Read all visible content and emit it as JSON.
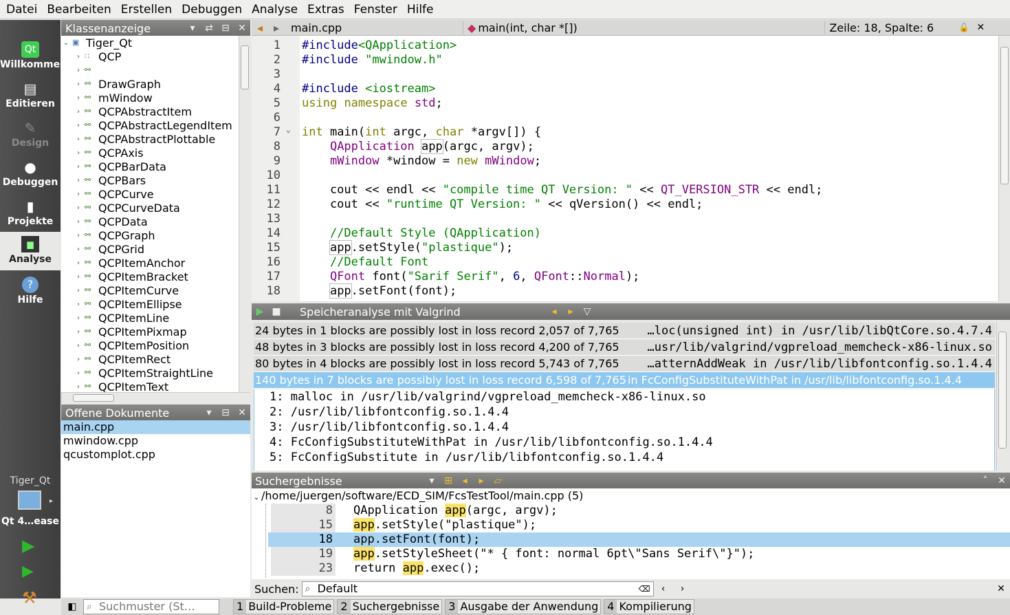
{
  "menu": [
    "Datei",
    "Bearbeiten",
    "Erstellen",
    "Debuggen",
    "Analyse",
    "Extras",
    "Fenster",
    "Hilfe"
  ],
  "modes": [
    {
      "label": "Willkommen",
      "icon": "qt-logo-icon"
    },
    {
      "label": "Editieren",
      "icon": "document-icon"
    },
    {
      "label": "Design",
      "icon": "pencil-icon"
    },
    {
      "label": "Debuggen",
      "icon": "bug-icon"
    },
    {
      "label": "Projekte",
      "icon": "wrench-icon"
    },
    {
      "label": "Analyse",
      "icon": "monitor-icon"
    },
    {
      "label": "Hilfe",
      "icon": "help-icon"
    }
  ],
  "target": {
    "project": "Tiger_Qt",
    "kit": "Qt 4…ease"
  },
  "class_panel": {
    "title": "Klassenanzeige",
    "root": "Tiger_Qt",
    "items": [
      "QCP",
      "",
      "DrawGraph",
      "mWindow",
      "QCPAbstractItem",
      "QCPAbstractLegendItem",
      "QCPAbstractPlottable",
      "QCPAxis",
      "QCPBarData",
      "QCPBars",
      "QCPCurve",
      "QCPCurveData",
      "QCPData",
      "QCPGraph",
      "QCPGrid",
      "QCPItemAnchor",
      "QCPItemBracket",
      "QCPItemCurve",
      "QCPItemEllipse",
      "QCPItemLine",
      "QCPItemPixmap",
      "QCPItemPosition",
      "QCPItemRect",
      "QCPItemStraightLine",
      "QCPItemText"
    ]
  },
  "open_docs": {
    "title": "Offene Dokumente",
    "items": [
      "main.cpp",
      "mwindow.cpp",
      "qcustomplot.cpp"
    ]
  },
  "editor": {
    "file": "main.cpp",
    "symbol": "main(int, char *[])",
    "position": "Zeile: 18, Spalte: 6",
    "lines": [
      {
        "n": "1",
        "html": "<span class='pp'>#include</span><span class='s'>&lt;QApplication&gt;</span>"
      },
      {
        "n": "2",
        "html": "<span class='pp'>#include</span> <span class='s'>\"mwindow.h\"</span>"
      },
      {
        "n": "3",
        "html": ""
      },
      {
        "n": "4",
        "html": "<span class='pp'>#include</span> <span class='s'>&lt;iostream&gt;</span>"
      },
      {
        "n": "5",
        "html": "<span class='k'>using</span> <span class='k'>namespace</span> <span class='q'>std</span>;"
      },
      {
        "n": "6",
        "html": ""
      },
      {
        "n": "7",
        "html": "<span class='t'>int</span> main(<span class='t'>int</span> argc, <span class='t'>char</span> *argv[]) {",
        "fold": true
      },
      {
        "n": "8",
        "html": "    <span class='cl'>QApplication</span> <span class='boxed'>app</span>(argc, argv);"
      },
      {
        "n": "9",
        "html": "    <span class='cl'>mWindow</span> *window = <span class='k'>new</span> <span class='cl'>mWindow</span>;"
      },
      {
        "n": "10",
        "html": ""
      },
      {
        "n": "11",
        "html": "    cout &lt;&lt; endl &lt;&lt; <span class='s'>\"compile time QT Version: \"</span> &lt;&lt; <span class='q'>QT_VERSION_STR</span> &lt;&lt; endl;"
      },
      {
        "n": "12",
        "html": "    cout &lt;&lt; <span class='s'>\"runtime QT Version: \"</span> &lt;&lt; qVersion() &lt;&lt; endl;"
      },
      {
        "n": "13",
        "html": ""
      },
      {
        "n": "14",
        "html": "    <span class='cm'>//Default Style (QApplication)</span>"
      },
      {
        "n": "15",
        "html": "    <span class='boxed'>app</span>.setStyle(<span class='s'>\"plastique\"</span>);"
      },
      {
        "n": "16",
        "html": "    <span class='cm'>//Default Font</span>"
      },
      {
        "n": "17",
        "html": "    <span class='cl'>QFont</span> font(<span class='s'>\"Sarif Serif\"</span>, <span class='pp'>6</span>, <span class='cl'>QFont</span>::<span class='q'>Normal</span>);"
      },
      {
        "n": "18",
        "html": "    <span class='boxed'>app</span>.setFont(font);"
      }
    ]
  },
  "valgrind": {
    "title": "Speicheranalyse mit Valgrind",
    "rows": [
      {
        "left": "24 bytes in 1 blocks are possibly lost in loss record 2,057 of 7,765",
        "right": "…loc(unsigned int) in /usr/lib/libQtCore.so.4.7.4"
      },
      {
        "left": "48 bytes in 3 blocks are possibly lost in loss record 4,200 of 7,765",
        "right": "…usr/lib/valgrind/vgpreload_memcheck-x86-linux.so"
      },
      {
        "left": "80 bytes in 4 blocks are possibly lost in loss record 5,743 of 7,765",
        "right": "…atternAddWeak in /usr/lib/libfontconfig.so.1.4.4"
      },
      {
        "left": "140 bytes in 7 blocks are possibly lost in loss record 6,598 of 7,765",
        "right": "in FcConfigSubstituteWithPat in /usr/lib/libfontconfig.so.1.4.4"
      }
    ],
    "stack": [
      "1: malloc in /usr/lib/valgrind/vgpreload_memcheck-x86-linux.so",
      "2: /usr/lib/libfontconfig.so.1.4.4",
      "3: /usr/lib/libfontconfig.so.1.4.4",
      "4: FcConfigSubstituteWithPat in /usr/lib/libfontconfig.so.1.4.4",
      "5: FcConfigSubstitute in /usr/lib/libfontconfig.so.1.4.4"
    ]
  },
  "search": {
    "title": "Suchergebnisse",
    "file": "/home/juergen/software/ECD_SIM/FcsTestTool/main.cpp (5)",
    "results": [
      {
        "n": "8",
        "pre": "QApplication ",
        "hit": "app",
        "post": "(argc, argv);"
      },
      {
        "n": "15",
        "pre": "",
        "hit": "app",
        "post": ".setStyle(\"plastique\");"
      },
      {
        "n": "18",
        "pre": "",
        "hit": "app",
        "post": ".setFont(font);"
      },
      {
        "n": "19",
        "pre": "",
        "hit": "app",
        "post": ".setStyleSheet(\"* { font: normal 6pt\\\"Sans Serif\\\"}\");"
      },
      {
        "n": "23",
        "pre": "return ",
        "hit": "app",
        "post": ".exec();"
      }
    ]
  },
  "find": {
    "label": "Suchen:",
    "value": "Default"
  },
  "status": {
    "locator_placeholder": "Suchmuster (St…",
    "panes": [
      {
        "num": "1",
        "label": "Build-Probleme"
      },
      {
        "num": "2",
        "label": "Suchergebnisse"
      },
      {
        "num": "3",
        "label": "Ausgabe der Anwendung"
      },
      {
        "num": "4",
        "label": "Kompilierung"
      }
    ]
  },
  "colors": {
    "selection": "#8ec8f0",
    "highlight": "#fbe36a"
  }
}
